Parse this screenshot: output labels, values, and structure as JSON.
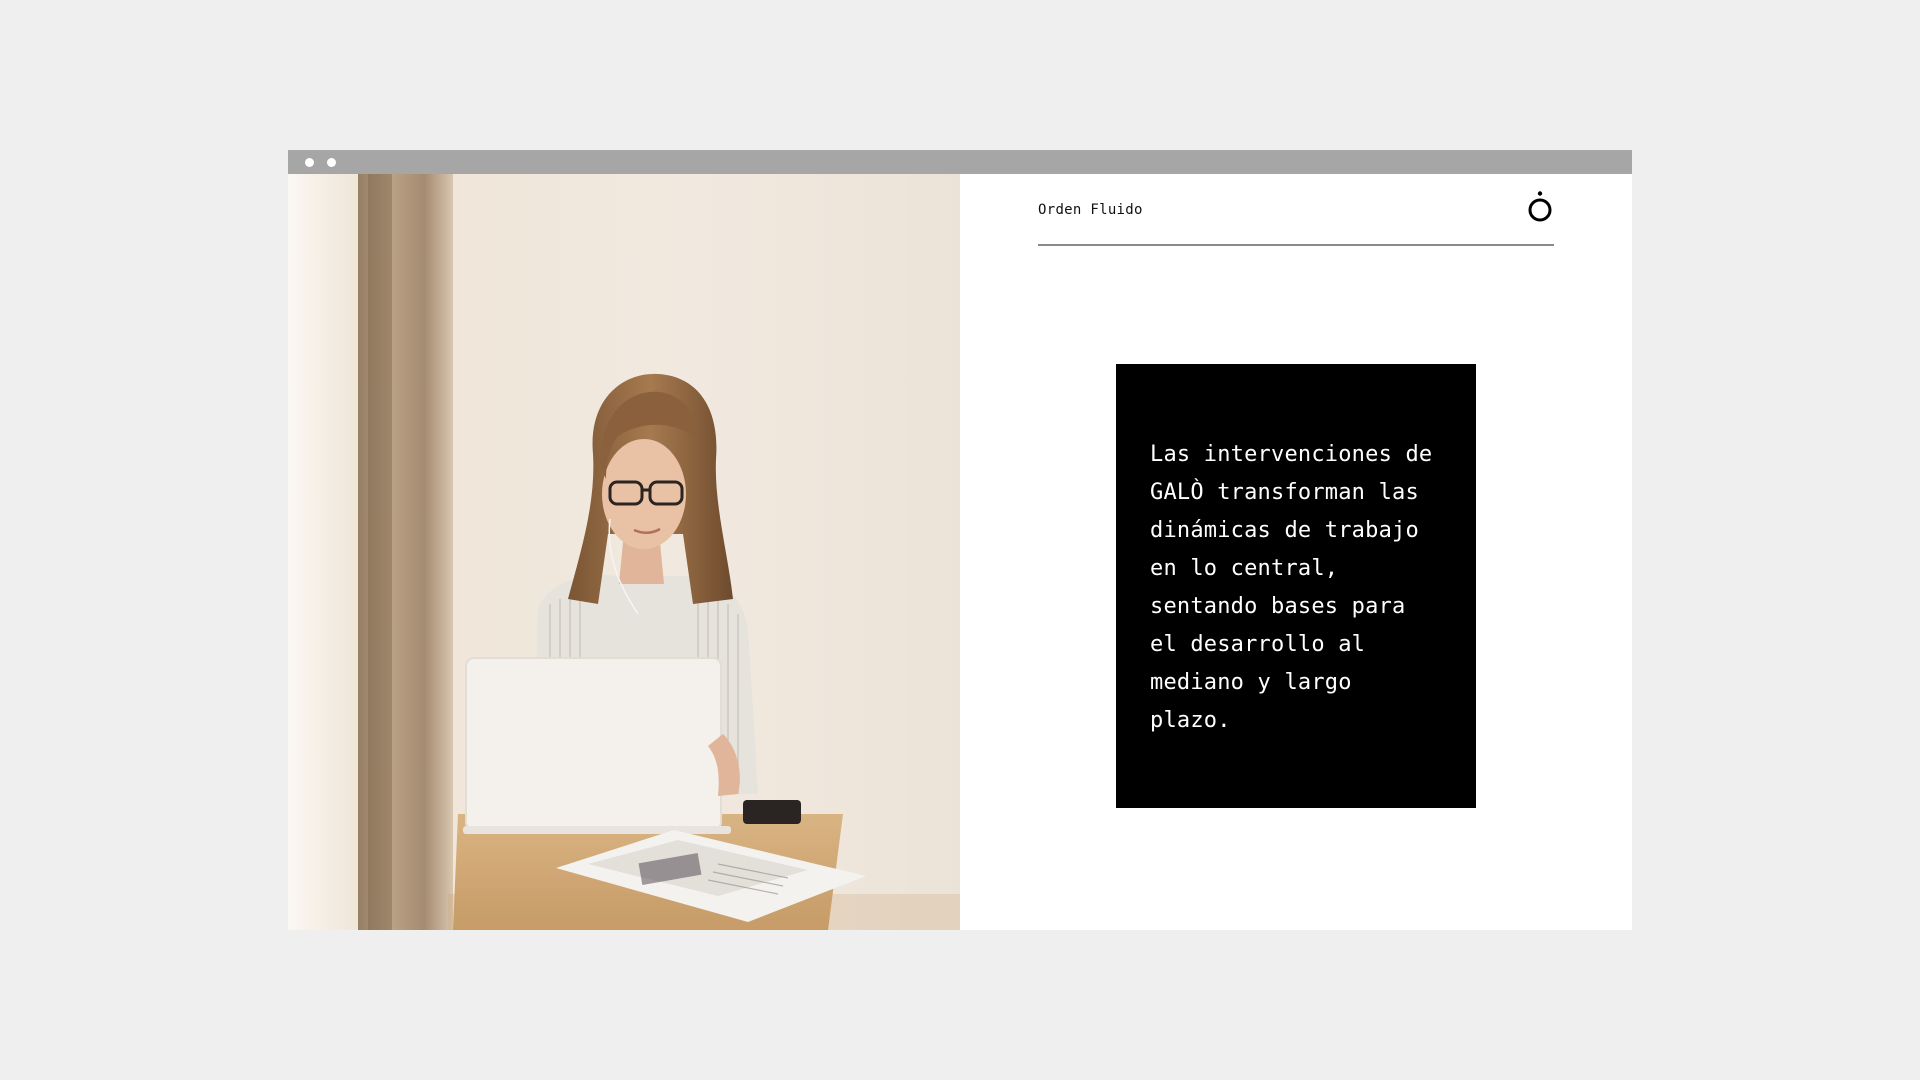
{
  "window": {
    "titlebar_dots": 2,
    "titlebar_color": "#a6a6a6",
    "background_color": "#efefef"
  },
  "photo": {
    "icon": "photo-woman-laptop"
  },
  "header": {
    "brand": "Orden Fluido",
    "logo_icon": "galo-o-logo-icon"
  },
  "quote": {
    "lines": [
      "Las intervenciones de",
      "GALÒ transforman las",
      "dinámicas de trabajo",
      "en lo central,",
      "sentando bases para",
      "el desarrollo al",
      "mediano y largo",
      "plazo."
    ],
    "box_color": "#000000",
    "text_color": "#ffffff"
  }
}
